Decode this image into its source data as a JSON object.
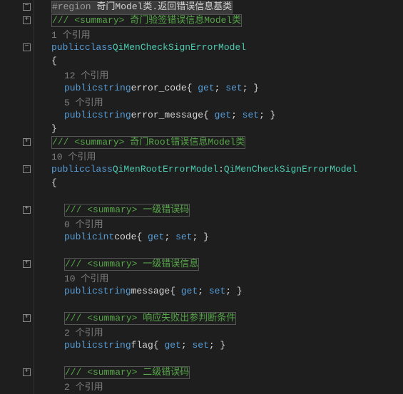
{
  "fold": {
    "minus": "−",
    "plus": "+"
  },
  "region": {
    "directive": "#region",
    "title": " 奇门Model类.返回错误信息基类"
  },
  "class1": {
    "summary": "/// <summary> 奇门验签错误信息Model类",
    "refs": "1 个引用",
    "decl_public": "public",
    "decl_class": "class",
    "name": "QiMenCheckSignErrorModel",
    "brace_open": "{",
    "brace_close": "}",
    "prop1": {
      "refs": "12 个引用",
      "kw_public": "public",
      "type": "string",
      "name": "error_code",
      "get": "get",
      "set": "set"
    },
    "prop2": {
      "refs": "5 个引用",
      "kw_public": "public",
      "type": "string",
      "name": "error_message",
      "get": "get",
      "set": "set"
    }
  },
  "class2": {
    "summary": "/// <summary> 奇门Root错误信息Model类",
    "refs": "10 个引用",
    "decl_public": "public",
    "decl_class": "class",
    "name": "QiMenRootErrorModel",
    "colon": ":",
    "base": "QiMenCheckSignErrorModel",
    "brace_open": "{",
    "prop1": {
      "summary": "/// <summary> 一级错误码",
      "refs": "0 个引用",
      "kw_public": "public",
      "type": "int",
      "name": "code",
      "get": "get",
      "set": "set"
    },
    "prop2": {
      "summary": "/// <summary> 一级错误信息",
      "refs": "10 个引用",
      "kw_public": "public",
      "type": "string",
      "name": "message",
      "get": "get",
      "set": "set"
    },
    "prop3": {
      "summary": "/// <summary> 响应失败出参判断条件",
      "refs": "2 个引用",
      "kw_public": "public",
      "type": "string",
      "name": "flag",
      "get": "get",
      "set": "set"
    },
    "prop4": {
      "summary": "/// <summary> 二级错误码",
      "refs": "2 个引用"
    }
  }
}
